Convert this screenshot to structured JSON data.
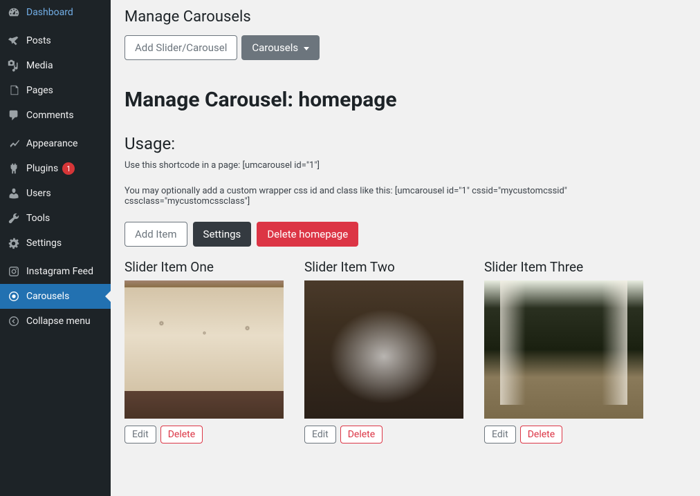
{
  "sidebar": {
    "items": [
      {
        "label": "Dashboard"
      },
      {
        "label": "Posts"
      },
      {
        "label": "Media"
      },
      {
        "label": "Pages"
      },
      {
        "label": "Comments"
      },
      {
        "label": "Appearance"
      },
      {
        "label": "Plugins",
        "badge": "1"
      },
      {
        "label": "Users"
      },
      {
        "label": "Tools"
      },
      {
        "label": "Settings"
      },
      {
        "label": "Instagram Feed"
      },
      {
        "label": "Carousels"
      },
      {
        "label": "Collapse menu"
      }
    ]
  },
  "page": {
    "title": "Manage Carousels",
    "add_button": "Add Slider/Carousel",
    "dropdown_label": "Carousels",
    "heading": "Manage Carousel: homepage",
    "usage_heading": "Usage:",
    "usage_line1": "Use this shortcode in a page: [umcarousel id=\"1\"]",
    "usage_line2": "You may optionally add a custom wrapper css id and class like this: [umcarousel id=\"1\" cssid=\"mycustomcssid\" cssclass=\"mycustomcssclass\"]",
    "add_item": "Add Item",
    "settings": "Settings",
    "delete_carousel": "Delete homepage"
  },
  "items": [
    {
      "title": "Slider Item One",
      "edit": "Edit",
      "delete": "Delete"
    },
    {
      "title": "Slider Item Two",
      "edit": "Edit",
      "delete": "Delete"
    },
    {
      "title": "Slider Item Three",
      "edit": "Edit",
      "delete": "Delete"
    }
  ]
}
